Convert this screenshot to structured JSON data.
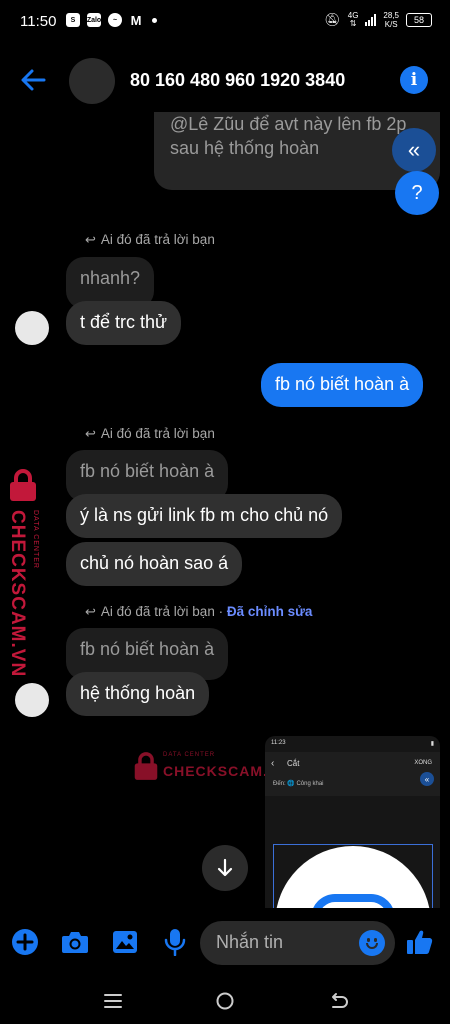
{
  "status": {
    "time": "11:50",
    "network": "4G",
    "speed_value": "28,5",
    "speed_unit": "K/S",
    "battery": "58"
  },
  "header": {
    "title": "80 160 480 960 1920 3840"
  },
  "top_quote": {
    "line1": "@Lê Zũu để avt này lên fb 2p",
    "line2": "sau hệ thống hoàn"
  },
  "floating": {
    "collapse_symbol": "«",
    "help_symbol": "?"
  },
  "messages": {
    "group1": {
      "reply_label": "Ai đó đã trả lời bạn",
      "quoted": "nhanh?",
      "reply": "t để trc thử"
    },
    "out1": "fb nó biết hoàn à",
    "group2": {
      "reply_label": "Ai đó đã trả lời bạn",
      "quoted": "fb nó biết hoàn à",
      "line1": "ý là ns gửi link fb m cho chủ nó",
      "line2": "chủ nó hoàn sao á"
    },
    "group3": {
      "reply_label": "Ai đó đã trả lời bạn",
      "edited_sep": " · ",
      "edited": "Đã chỉnh sửa",
      "quoted": "fb nó biết hoàn à",
      "reply": "hệ thống hoàn"
    }
  },
  "watermark": {
    "brand": "CHECKSCAM.VN",
    "sub": "DATA CENTER"
  },
  "thumbnail": {
    "time": "11:23",
    "title": "Cắt",
    "done": "XONG",
    "to_label": "Đến: 🌐 Công khai"
  },
  "composer": {
    "placeholder": "Nhắn tin"
  },
  "colors": {
    "accent": "#1877f2",
    "incoming": "#303030",
    "watermark": "#c2183a"
  }
}
